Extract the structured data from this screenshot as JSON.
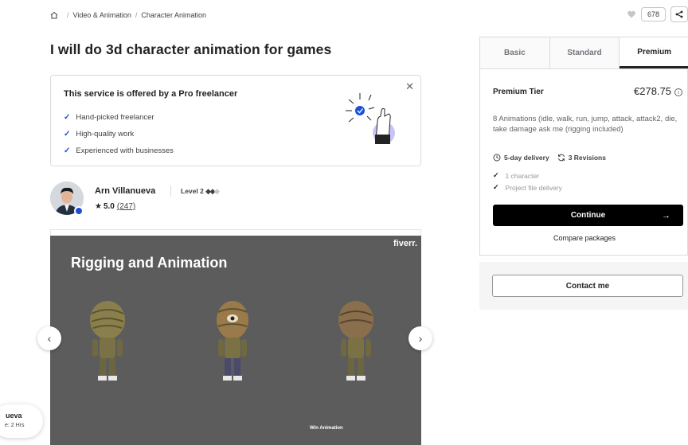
{
  "breadcrumb": {
    "items": [
      "Video & Animation",
      "Character Animation"
    ],
    "separator": "/"
  },
  "actions": {
    "likes": "678"
  },
  "gig": {
    "title": "I will do 3d character animation for games"
  },
  "pro_box": {
    "title": "This service is offered by a Pro freelancer",
    "items": [
      "Hand-picked freelancer",
      "High-quality work",
      "Experienced with businesses"
    ]
  },
  "seller": {
    "name": "Arn Villanueva",
    "level_label": "Level 2",
    "rating": "5.0",
    "reviews": "(247)"
  },
  "gallery": {
    "title": "Rigging and Animation",
    "brand": "fiverr.",
    "caption": "Win Animation"
  },
  "chat": {
    "name": "ueva",
    "status": "e: 2 Hrs"
  },
  "packages": {
    "tabs": [
      "Basic",
      "Standard",
      "Premium"
    ],
    "active_tab": "Premium",
    "tier_name": "Premium Tier",
    "price": "€278.75",
    "description": "8 Animations (idle, walk, run, jump, attack, attack2, die, take damage ask me (rigging included)",
    "delivery": "5-day delivery",
    "revisions": "3 Revisions",
    "features": [
      "1 character",
      "Project file delivery"
    ],
    "continue_label": "Continue",
    "compare_label": "Compare packages"
  },
  "contact": {
    "label": "Contact me"
  },
  "colors": {
    "accent_blue": "#1d4ed8",
    "primary_button": "#000000",
    "gallery_bg": "#5c5c5c"
  }
}
